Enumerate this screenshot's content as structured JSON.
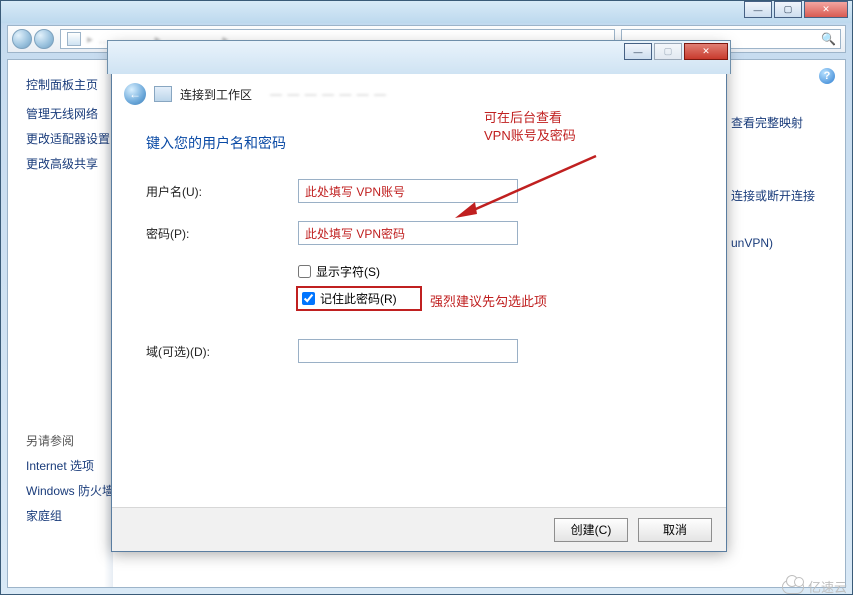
{
  "outer": {
    "breadcrumb_placeholder": "▸ ………… ▸ ………… ▸ …………",
    "search_icon": "🔍"
  },
  "sidebar": {
    "header": "控制面板主页",
    "items": [
      {
        "label": "管理无线网络"
      },
      {
        "label": "更改适配器设置"
      },
      {
        "label": "更改高级共享"
      }
    ],
    "see_also_header": "另请参阅",
    "see_also": [
      {
        "label": "Internet 选项"
      },
      {
        "label": "Windows 防火墙"
      },
      {
        "label": "家庭组"
      }
    ]
  },
  "rightlinks": {
    "help": "?",
    "items": [
      {
        "label": "查看完整映射"
      },
      {
        "label": "连接或断开连接"
      },
      {
        "label": "unVPN)"
      }
    ]
  },
  "dialog": {
    "title": "连接到工作区",
    "instruction": "键入您的用户名和密码",
    "labels": {
      "username": "用户名(U):",
      "password": "密码(P):",
      "show_chars": "显示字符(S)",
      "remember_pwd": "记住此密码(R)",
      "domain_optional": "域(可选)(D):"
    },
    "values": {
      "username": "此处填写 VPN账号",
      "password": "此处填写 VPN密码",
      "show_chars_checked": false,
      "remember_pwd_checked": true,
      "domain": ""
    },
    "buttons": {
      "create": "创建(C)",
      "cancel": "取消"
    }
  },
  "annotations": {
    "backend_note": "可在后台查看\nVPN账号及密码",
    "remember_note": "强烈建议先勾选此项"
  },
  "watermark": "亿速云"
}
